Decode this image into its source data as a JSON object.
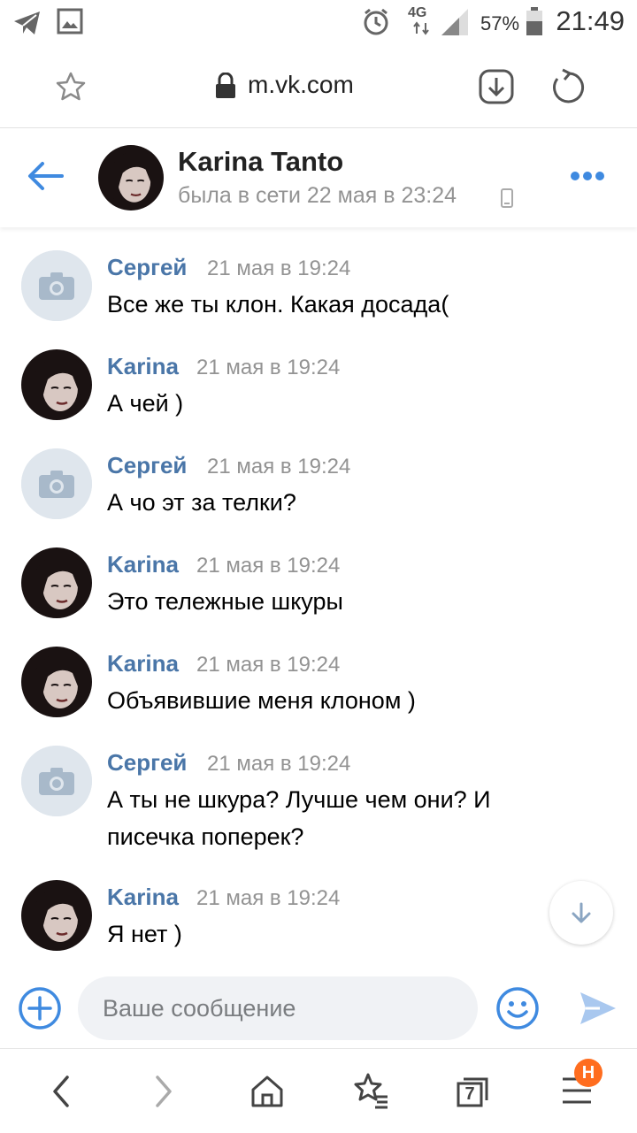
{
  "status_bar": {
    "time": "21:49",
    "battery_percent": "57%",
    "network": "4G",
    "icons": [
      "telegram-icon",
      "gallery-icon",
      "alarm-icon",
      "signal-icon",
      "battery-icon"
    ]
  },
  "browser": {
    "url": "m.vk.com",
    "icons": [
      "star-icon",
      "lock-icon",
      "download-icon",
      "reload-icon"
    ]
  },
  "chat_header": {
    "name": "Karina Tanto",
    "status": "была в сети 22 мая в 23:24",
    "icons": [
      "back-arrow-icon",
      "mobile-device-icon",
      "more-icon"
    ]
  },
  "messages": [
    {
      "author": "Сергей",
      "time": "21 мая в 19:24",
      "lines": [
        "Все же ты клон. Какая досада("
      ],
      "avatar": "camera"
    },
    {
      "author": "Karina",
      "time": "21 мая в 19:24",
      "lines": [
        "А чей )"
      ],
      "avatar": "photo"
    },
    {
      "author": "Сергей",
      "time": "21 мая в 19:24",
      "lines": [
        "А чо эт за телки?"
      ],
      "avatar": "camera"
    },
    {
      "author": "Karina",
      "time": "21 мая в 19:24",
      "lines": [
        "Это тележные шкуры"
      ],
      "avatar": "photo"
    },
    {
      "author": "Karina",
      "time": "21 мая в 19:24",
      "lines": [
        "Объявившие меня клоном )"
      ],
      "avatar": "photo"
    },
    {
      "author": "Сергей",
      "time": "21 мая в 19:24",
      "lines": [
        "А ты не шкура? Лучше чем они? И",
        "писечка поперек?"
      ],
      "avatar": "camera"
    },
    {
      "author": "Karina",
      "time": "21 мая в 19:24",
      "lines": [
        "Я нет )"
      ],
      "avatar": "photo"
    }
  ],
  "input": {
    "placeholder": "Ваше сообщение",
    "icons": [
      "add-icon",
      "emoji-icon",
      "send-icon"
    ]
  },
  "bottom_nav": {
    "items": [
      "back-icon",
      "forward-icon",
      "home-icon",
      "bookmarks-icon",
      "tabs-icon",
      "menu-icon"
    ],
    "tabs_count": "7",
    "badge": "H"
  },
  "colors": {
    "accent": "#4a76a8",
    "link_blue": "#3f8ae0",
    "muted": "#939393",
    "badge": "#ff6d1f"
  }
}
